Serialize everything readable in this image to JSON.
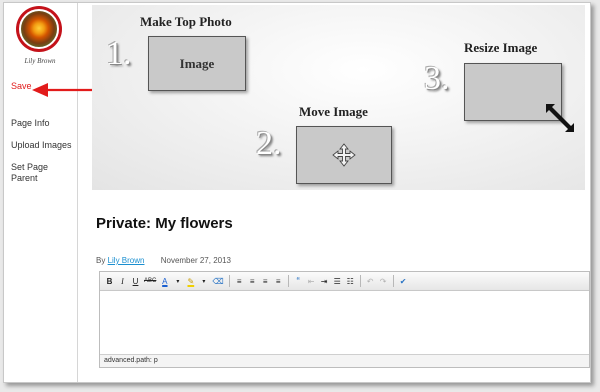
{
  "user": {
    "name": "Lily Brown"
  },
  "sidebar": {
    "save_label": "Save",
    "items": [
      {
        "label": "Page Info"
      },
      {
        "label": "Upload Images"
      },
      {
        "label": "Set Page Parent"
      }
    ]
  },
  "hero": {
    "steps": [
      {
        "number": "1.",
        "title": "Make Top Photo",
        "box_label": "Image"
      },
      {
        "number": "2.",
        "title": "Move Image",
        "box_icon": "move-arrows-icon"
      },
      {
        "number": "3.",
        "title": "Resize Image",
        "box_icon": "resize-arrow-icon"
      }
    ]
  },
  "page": {
    "title": "Private: My flowers",
    "byline_prefix": "By",
    "author": "Lily Brown",
    "date": "November 27, 2013"
  },
  "editor": {
    "toolbar": {
      "bold": "B",
      "italic": "I",
      "underline": "U",
      "strike": "ABC",
      "font_color": "A",
      "highlight": "✎",
      "clear": "⌫",
      "align_left": "≡",
      "align_center": "≡",
      "align_right": "≡",
      "justify": "≡",
      "quote": "“",
      "outdent": "⇤",
      "indent": "⇥",
      "bullets": "☰",
      "numbers": "☷",
      "undo": "↶",
      "redo": "↷",
      "spellcheck": "✔"
    },
    "status": "advanced.path: p"
  },
  "colors": {
    "accent_red": "#e21b1b",
    "link_blue": "#1a8fd0",
    "avatar_ring": "#c4121a"
  }
}
